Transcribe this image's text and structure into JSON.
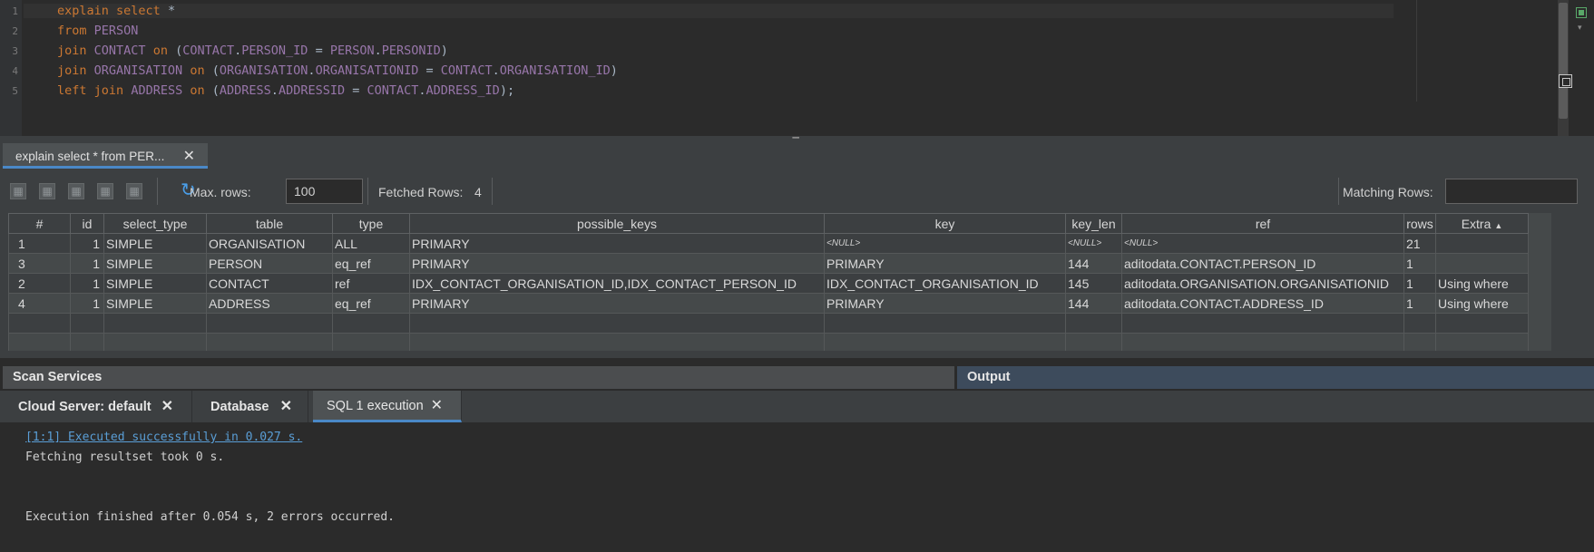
{
  "editor": {
    "line_numbers": [
      "1",
      "2",
      "3",
      "4",
      "5"
    ],
    "lines": [
      [
        {
          "t": "explain",
          "c": "kw"
        },
        {
          "t": " ",
          "c": "pn"
        },
        {
          "t": "select",
          "c": "kw"
        },
        {
          "t": " *",
          "c": "pn"
        }
      ],
      [
        {
          "t": "from",
          "c": "kw"
        },
        {
          "t": " ",
          "c": "pn"
        },
        {
          "t": "PERSON",
          "c": "id"
        }
      ],
      [
        {
          "t": "join",
          "c": "kw"
        },
        {
          "t": " ",
          "c": "pn"
        },
        {
          "t": "CONTACT",
          "c": "id"
        },
        {
          "t": " ",
          "c": "pn"
        },
        {
          "t": "on",
          "c": "kw"
        },
        {
          "t": " (",
          "c": "pn"
        },
        {
          "t": "CONTACT",
          "c": "id"
        },
        {
          "t": ".",
          "c": "pn"
        },
        {
          "t": "PERSON_ID",
          "c": "id"
        },
        {
          "t": " = ",
          "c": "pn"
        },
        {
          "t": "PERSON",
          "c": "id"
        },
        {
          "t": ".",
          "c": "pn"
        },
        {
          "t": "PERSONID",
          "c": "id"
        },
        {
          "t": ")",
          "c": "pn"
        }
      ],
      [
        {
          "t": "join",
          "c": "kw"
        },
        {
          "t": " ",
          "c": "pn"
        },
        {
          "t": "ORGANISATION",
          "c": "id"
        },
        {
          "t": " ",
          "c": "pn"
        },
        {
          "t": "on",
          "c": "kw"
        },
        {
          "t": " (",
          "c": "pn"
        },
        {
          "t": "ORGANISATION",
          "c": "id"
        },
        {
          "t": ".",
          "c": "pn"
        },
        {
          "t": "ORGANISATIONID",
          "c": "id"
        },
        {
          "t": " = ",
          "c": "pn"
        },
        {
          "t": "CONTACT",
          "c": "id"
        },
        {
          "t": ".",
          "c": "pn"
        },
        {
          "t": "ORGANISATION_ID",
          "c": "id"
        },
        {
          "t": ")",
          "c": "pn"
        }
      ],
      [
        {
          "t": "left",
          "c": "kw"
        },
        {
          "t": " ",
          "c": "pn"
        },
        {
          "t": "join",
          "c": "kw"
        },
        {
          "t": " ",
          "c": "pn"
        },
        {
          "t": "ADDRESS",
          "c": "id"
        },
        {
          "t": " ",
          "c": "pn"
        },
        {
          "t": "on",
          "c": "kw"
        },
        {
          "t": " (",
          "c": "pn"
        },
        {
          "t": "ADDRESS",
          "c": "id"
        },
        {
          "t": ".",
          "c": "pn"
        },
        {
          "t": "ADDRESSID",
          "c": "id"
        },
        {
          "t": " = ",
          "c": "pn"
        },
        {
          "t": "CONTACT",
          "c": "id"
        },
        {
          "t": ".",
          "c": "pn"
        },
        {
          "t": "ADDRESS_ID",
          "c": "id"
        },
        {
          "t": ");",
          "c": "pn"
        }
      ]
    ]
  },
  "result_tab": {
    "label": "explain select * from PER...",
    "close": "✕"
  },
  "toolbar": {
    "max_rows_label": "Max. rows:",
    "max_rows_value": "100",
    "fetched_rows_label": "Fetched Rows:",
    "fetched_rows_value": "4",
    "matching_rows_label": "Matching Rows:",
    "matching_rows_value": "",
    "icons": [
      "grid-icon",
      "grid-icon",
      "grid-icon",
      "grid-icon",
      "grid-icon",
      "refresh-icon"
    ]
  },
  "table": {
    "columns": [
      "#",
      "id",
      "select_type",
      "table",
      "type",
      "possible_keys",
      "key",
      "key_len",
      "ref",
      "rows",
      "Extra"
    ],
    "sorted_column": "Extra",
    "sort_direction": "ascending",
    "null_label": "<NULL>",
    "rows": [
      [
        "1",
        "1",
        "SIMPLE",
        "ORGANISATION",
        "ALL",
        "PRIMARY",
        null,
        null,
        null,
        "21",
        ""
      ],
      [
        "3",
        "1",
        "SIMPLE",
        "PERSON",
        "eq_ref",
        "PRIMARY",
        "PRIMARY",
        "144",
        "aditodata.CONTACT.PERSON_ID",
        "1",
        ""
      ],
      [
        "2",
        "1",
        "SIMPLE",
        "CONTACT",
        "ref",
        "IDX_CONTACT_ORGANISATION_ID,IDX_CONTACT_PERSON_ID",
        "IDX_CONTACT_ORGANISATION_ID",
        "145",
        "aditodata.ORGANISATION.ORGANISATIONID",
        "1",
        "Using where"
      ],
      [
        "4",
        "1",
        "SIMPLE",
        "ADDRESS",
        "eq_ref",
        "PRIMARY",
        "PRIMARY",
        "144",
        "aditodata.CONTACT.ADDRESS_ID",
        "1",
        "Using where"
      ]
    ]
  },
  "panels": {
    "scan_services": "Scan Services",
    "output": "Output"
  },
  "bottom_tabs": [
    {
      "label": "Cloud Server: default",
      "close": "✕",
      "active": false
    },
    {
      "label": "Database",
      "close": "✕",
      "active": false
    },
    {
      "label": "SQL 1 execution",
      "close": "✕",
      "active": true
    }
  ],
  "console": {
    "lines": [
      {
        "text": "[1:1] Executed successfully in 0.027 s.",
        "link": true
      },
      {
        "text": "Fetching resultset took 0 s.",
        "link": false
      },
      {
        "text": "",
        "link": false
      },
      {
        "text": "Execution finished after 0.054 s, 2 errors occurred.",
        "link": false
      }
    ]
  },
  "colors": {
    "background": "#2b2b2b",
    "panel": "#3c3f41",
    "keyword": "#cc7832",
    "identifier": "#9876aa",
    "accent": "#4a88c7",
    "link": "#5a9ed6",
    "status_ok": "#59a869"
  }
}
